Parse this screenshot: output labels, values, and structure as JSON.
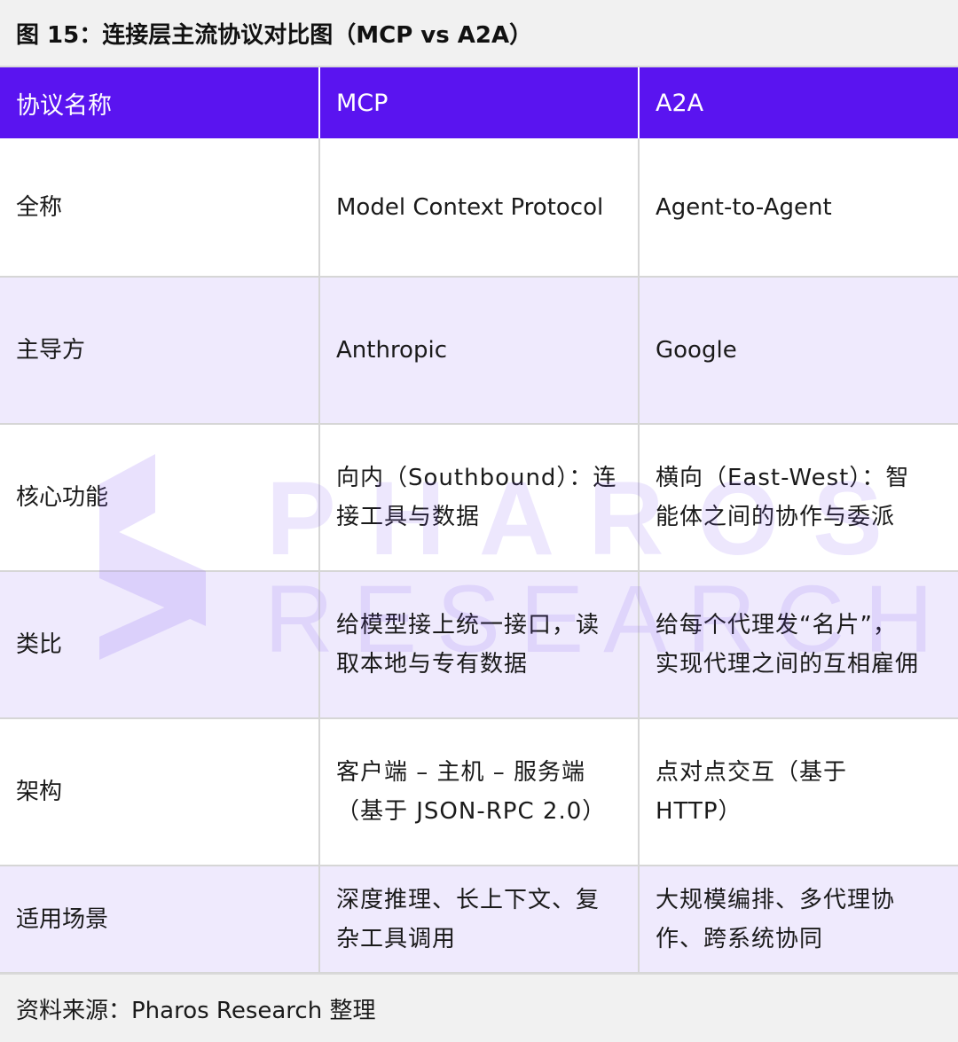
{
  "title": "图 15：连接层主流协议对比图（MCP vs A2A）",
  "table": {
    "headers": [
      "协议名称",
      "MCP",
      "A2A"
    ],
    "rows": [
      {
        "label": "全称",
        "mcp": "Model Context Protocol",
        "a2a": "Agent-to-Agent"
      },
      {
        "label": "主导方",
        "mcp": "Anthropic",
        "a2a": "Google"
      },
      {
        "label": "核心功能",
        "mcp": [
          "向内（Southbound）：连",
          "接工具与数据"
        ],
        "a2a": [
          "横向（East-West）：智",
          "能体之间的协作与委派"
        ]
      },
      {
        "label": "类比",
        "mcp": [
          "给模型接上统一接口，读",
          "取本地与专有数据"
        ],
        "a2a": [
          "给每个代理发“名片”，",
          "实现代理之间的互相雇佣"
        ]
      },
      {
        "label": "架构",
        "mcp": [
          "客户端 – 主机 – 服务端",
          "（基于 JSON-RPC 2.0）"
        ],
        "a2a": [
          "点对点交互（基于",
          "HTTP）"
        ]
      },
      {
        "label": "适用场景",
        "mcp": [
          "深度推理、长上下文、复",
          "杂工具调用"
        ],
        "a2a": [
          "大规模编排、多代理协",
          "作、跨系统协同"
        ]
      }
    ]
  },
  "watermark": {
    "line1": "PHAROS",
    "line2": "RESEARCH",
    "color": "#7b4cf5"
  },
  "footer": "资料来源：Pharos Research 整理",
  "colors": {
    "header_bg": "#5a14f0",
    "row_alt": "#efeafd",
    "title_bg": "#f1f1f1"
  }
}
